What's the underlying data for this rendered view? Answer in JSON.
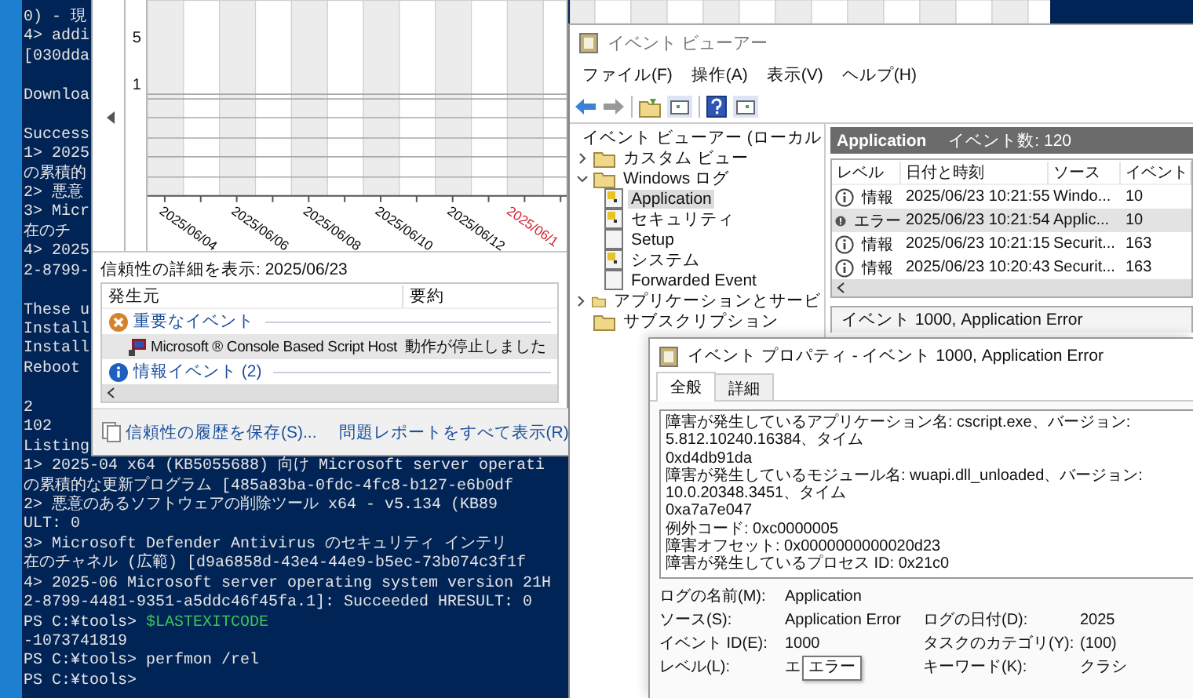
{
  "terminal": {
    "lines": [
      {
        "kind": "output",
        "text": "0) - 現"
      },
      {
        "kind": "output",
        "text": "4> addi"
      },
      {
        "kind": "output",
        "text": "[030dda"
      },
      {
        "kind": "blank"
      },
      {
        "kind": "output",
        "text": "Downloa"
      },
      {
        "kind": "blank"
      },
      {
        "kind": "output",
        "text": "Success"
      },
      {
        "kind": "output",
        "text": "1> 2025"
      },
      {
        "kind": "output",
        "text": "の累積的"
      },
      {
        "kind": "output",
        "text": "2> 悪意"
      },
      {
        "kind": "output",
        "text": "3> Micr"
      },
      {
        "kind": "output",
        "text": "在のチ"
      },
      {
        "kind": "output",
        "text": "4> 2025"
      },
      {
        "kind": "output",
        "text": "2-8799-"
      },
      {
        "kind": "blank"
      },
      {
        "kind": "output",
        "text": "These u"
      },
      {
        "kind": "output",
        "text": "Install"
      },
      {
        "kind": "output",
        "text": "Install"
      },
      {
        "kind": "output",
        "text": "Reboot"
      },
      {
        "kind": "blank"
      },
      {
        "kind": "output",
        "text": "2"
      },
      {
        "kind": "output",
        "text": "102"
      },
      {
        "kind": "output",
        "text": "Listing"
      },
      {
        "kind": "output",
        "text": "1> 2025-04 x64 (KB5055688) 向け Microsoft server operati"
      },
      {
        "kind": "output",
        "text": "の累積的な更新プログラム [485a83ba-0fdc-4fc8-b127-e6b0df"
      },
      {
        "kind": "output",
        "text": "2> 悪意のあるソフトウェアの削除ツール x64 - v5.134 (KB89"
      },
      {
        "kind": "output",
        "text": "ULT: 0"
      },
      {
        "kind": "output",
        "text": "3> Microsoft Defender Antivirus のセキュリティ インテリ"
      },
      {
        "kind": "output",
        "text": "在のチャネル (広範) [d9a6858d-43e4-44e9-b5ec-73b074c3f1f"
      },
      {
        "kind": "output",
        "text": "4> 2025-06 Microsoft server operating system version 21H"
      },
      {
        "kind": "output",
        "text": "2-8799-4481-9351-a5ddc46f45fa.1]: Succeeded HRESULT: 0"
      },
      {
        "kind": "variable",
        "prompt": "PS C:¥tools>",
        "command": "$LASTEXITCODE"
      },
      {
        "kind": "output",
        "text": "-1073741819"
      },
      {
        "kind": "command",
        "prompt": "PS C:¥tools>",
        "command": "perfmon /rel"
      },
      {
        "kind": "prompt",
        "prompt": "PS C:¥tools>"
      }
    ]
  },
  "reliability": {
    "chart": {
      "y_labels": [
        "5",
        "1"
      ],
      "date_labels": [
        {
          "text": "2025/06/04",
          "color": "#000000"
        },
        {
          "text": "2025/06/06",
          "color": "#000000"
        },
        {
          "text": "2025/06/08",
          "color": "#000000"
        },
        {
          "text": "2025/06/10",
          "color": "#000000"
        },
        {
          "text": "2025/06/12",
          "color": "#000000"
        },
        {
          "text": "2025/06/1",
          "color": "#d02030"
        }
      ]
    },
    "details_title": "信頼性の詳細を表示: 2025/06/23",
    "table": {
      "columns": [
        "発生元",
        "要約"
      ],
      "groups": [
        {
          "kind": "critical",
          "label": "重要なイベント",
          "rows": [
            {
              "source": "Microsoft ® Console Based Script Host",
              "summary": "動作が停止しました",
              "selected": true
            }
          ]
        },
        {
          "kind": "info",
          "label": "情報イベント (2)"
        }
      ]
    },
    "links": [
      "信頼性の履歴を保存(S)...",
      "問題レポートをすべて表示(R)"
    ]
  },
  "event_viewer": {
    "title": "イベント ビューアー",
    "menu": [
      "ファイル(F)",
      "操作(A)",
      "表示(V)",
      "ヘルプ(H)"
    ],
    "tree": [
      {
        "label": "イベント ビューアー (ローカル",
        "kind": "root",
        "selected": false,
        "children": [
          {
            "label": "カスタム ビュー",
            "kind": "folder",
            "expanded": false,
            "selected": false
          },
          {
            "label": "Windows ログ",
            "kind": "folder",
            "expanded": true,
            "selected": false,
            "children": [
              {
                "label": "Application",
                "kind": "log",
                "selected": true
              },
              {
                "label": "セキュリティ",
                "kind": "log",
                "selected": false
              },
              {
                "label": "Setup",
                "kind": "empty_log",
                "selected": false
              },
              {
                "label": "システム",
                "kind": "log",
                "selected": false
              },
              {
                "label": "Forwarded Event",
                "kind": "empty_log",
                "selected": false
              }
            ]
          },
          {
            "label": "アプリケーションとサービ",
            "kind": "folder",
            "expanded": false,
            "selected": false
          },
          {
            "label": "サブスクリプション",
            "kind": "folder",
            "selected": false
          }
        ]
      }
    ],
    "list": {
      "title": "Application",
      "count": "イベント数: 120",
      "columns": [
        "レベル",
        "日付と時刻",
        "ソース",
        "イベント"
      ],
      "rows": [
        {
          "kind": "info",
          "level": "情報",
          "datetime": "2025/06/23 10:21:55",
          "source": "Windo...",
          "event_id": "10",
          "selected": false
        },
        {
          "kind": "error",
          "level": "エラー",
          "datetime": "2025/06/23 10:21:54",
          "source": "Applic...",
          "event_id": "10",
          "selected": true
        },
        {
          "kind": "info",
          "level": "情報",
          "datetime": "2025/06/23 10:21:15",
          "source": "Securit...",
          "event_id": "163",
          "selected": false
        },
        {
          "kind": "info",
          "level": "情報",
          "datetime": "2025/06/23 10:20:43",
          "source": "Securit...",
          "event_id": "163",
          "selected": false
        }
      ]
    },
    "preview_title": "イベント 1000, Application Error"
  },
  "properties": {
    "title": "イベント プロパティ - イベント 1000, Application Error",
    "tabs": [
      {
        "label": "全般",
        "selected": true
      },
      {
        "label": "詳細",
        "selected": false
      }
    ],
    "description": [
      "障害が発生しているアプリケーション名: cscript.exe、バージョン: 5.812.10240.16384、タイム",
      "0xd4db91da",
      "障害が発生しているモジュール名: wuapi.dll_unloaded、バージョン: 10.0.20348.3451、タイム",
      "0xa7a7e047",
      "例外コード: 0xc0000005",
      "障害オフセット: 0x0000000000020d23",
      "障害が発生しているプロセス ID: 0x21c0"
    ],
    "fields": [
      {
        "cells": [
          {
            "label": "ログの名前(M):",
            "value": "Application"
          }
        ]
      },
      {
        "cells": [
          {
            "label": "ソース(S):",
            "value": "Application Error"
          },
          {
            "label": "ログの日付(D):",
            "value": "2025"
          }
        ]
      },
      {
        "cells": [
          {
            "label": "イベント ID(E):",
            "value": "1000"
          },
          {
            "label": "タスクのカテゴリ(Y):",
            "value": "(100)"
          }
        ]
      },
      {
        "cells": [
          {
            "label": "レベル(L):",
            "value": "エ",
            "tooltip": "エラー"
          },
          {
            "label": "キーワード(K):",
            "value": "クラシ"
          }
        ]
      }
    ]
  }
}
